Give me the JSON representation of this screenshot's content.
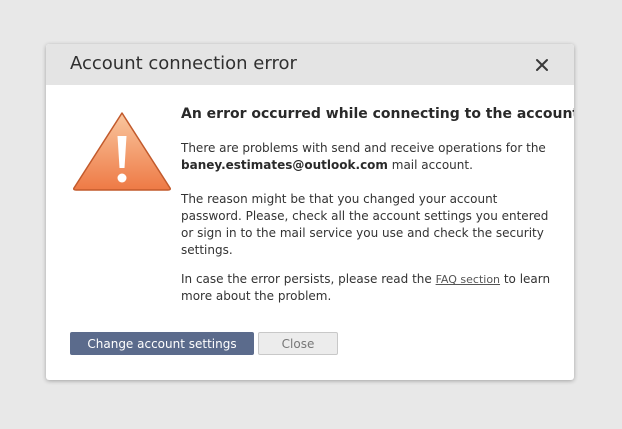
{
  "dialog": {
    "title": "Account connection error",
    "close_icon": "close-icon",
    "warning_icon": "warning-triangle-icon",
    "colors": {
      "titlebar": "#e4e4e4",
      "primary_button": "#5b6b8c",
      "warning_top": "#f9c79f",
      "warning_bottom": "#ee7a45"
    }
  },
  "message": {
    "heading": "An error occurred while connecting to the account.",
    "problems_prefix": "There are problems with send and receive operations for the",
    "email": "baney.estimates@outlook.com",
    "problems_suffix": "mail account.",
    "reason": "The reason might be that you changed your account password. Please, check all the account settings you entered or sign in to the mail service you use and check the security settings.",
    "persist_prefix": "In case the error persists, please read the",
    "faq_link": "FAQ section",
    "persist_suffix": "to learn more about the problem."
  },
  "buttons": {
    "change_settings": "Change account settings",
    "close": "Close"
  }
}
